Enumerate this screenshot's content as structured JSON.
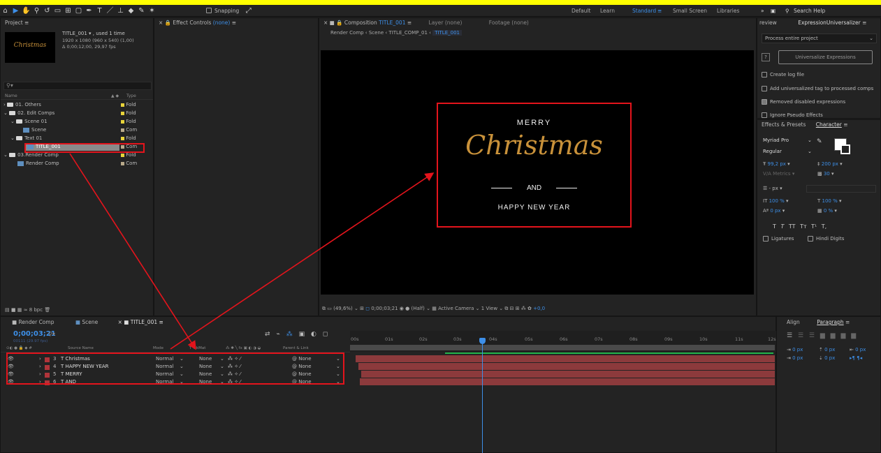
{
  "toolbar": {
    "snapping": "Snapping"
  },
  "workspaces": [
    "Default",
    "Learn",
    "Standard",
    "Small Screen",
    "Libraries"
  ],
  "search_help": "Search Help",
  "project": {
    "tab": "Project",
    "asset_name": "TITLE_001",
    "asset_used": ", used 1 time",
    "asset_dims": "1920 x 1080  (960 x 540) (1,00)",
    "asset_time": "Δ 0;00;12;00, 29,97 fps",
    "thumb_text": "Christmas",
    "col_name": "Name",
    "col_type": "Type",
    "items": [
      {
        "label": "01. Others",
        "type": "Fold"
      },
      {
        "label": "02. Edit Comps",
        "type": "Fold"
      },
      {
        "label": "Scene 01",
        "type": "Fold"
      },
      {
        "label": "Scene",
        "type": "Com"
      },
      {
        "label": "Text 01",
        "type": "Fold"
      },
      {
        "label": "TITLE_001",
        "type": "Com"
      },
      {
        "label": "03.Render Comp",
        "type": "Fold"
      },
      {
        "label": "Render Comp",
        "type": "Com"
      }
    ],
    "bpc": "8 bpc"
  },
  "effect_controls": {
    "label": "Effect Controls",
    "value": "(none)"
  },
  "composition": {
    "tab_prefix": "Composition",
    "tab_name": "TITLE_001",
    "layer_tab": "Layer  (none)",
    "footage_tab": "Footage  (none)",
    "breadcrumbs": [
      "Render Comp",
      "Scene",
      "TITLE_COMP_01",
      "TITLE_001"
    ],
    "title_merry": "MERRY",
    "title_christmas": "Christmas",
    "title_and": "AND",
    "title_happy": "HAPPY NEW YEAR",
    "zoom": "(49,6%)",
    "timecode": "0;00;03;21",
    "resolution": "(Half)",
    "camera": "Active Camera",
    "view": "1 View",
    "exposure": "+0,0"
  },
  "expression_panel": {
    "tab_review": "review",
    "tab_name": "ExpressionUniversalizer",
    "scope": "Process entire project",
    "button": "Universalize Expressions",
    "options": [
      {
        "label": "Create log file",
        "checked": false
      },
      {
        "label": "Add universalized tag to processed comps",
        "checked": false
      },
      {
        "label": "Removed disabled expressions",
        "checked": true
      },
      {
        "label": "Ignore Pseudo Effects",
        "checked": false
      }
    ]
  },
  "character": {
    "tab_effects": "Effects & Presets",
    "tab_character": "Character",
    "font": "Myriad Pro",
    "style": "Regular",
    "size": "99,2 px",
    "leading": "200 px",
    "kerning": "Metrics",
    "tracking": "30",
    "stroke": "- px",
    "vscale": "100 %",
    "hscale": "100 %",
    "baseline": "0 px",
    "tsume": "0 %",
    "style_buttons": [
      "T",
      "T",
      "TT",
      "Tт",
      "T¹",
      "T,"
    ],
    "ligatures": "Ligatures",
    "hindi": "Hindi Digits"
  },
  "timeline": {
    "tabs": [
      "Render Comp",
      "Scene",
      "TITLE_001"
    ],
    "timecode": "0;00;03;21",
    "frames": "00111 (29.97 fps)",
    "col_source": "Source Name",
    "col_mode": "Mode",
    "col_trk": "T  TrkMat",
    "col_parent": "Parent & Link",
    "layers": [
      {
        "num": "3",
        "name": "Christmas",
        "mode": "Normal",
        "trk": "None",
        "parent": "None"
      },
      {
        "num": "4",
        "name": "HAPPY NEW YEAR",
        "mode": "Normal",
        "trk": "None",
        "parent": "None"
      },
      {
        "num": "5",
        "name": "MERRY",
        "mode": "Normal",
        "trk": "None",
        "parent": "None"
      },
      {
        "num": "6",
        "name": "AND",
        "mode": "Normal",
        "trk": "None",
        "parent": "None"
      }
    ],
    "ticks": [
      "00s",
      "01s",
      "02s",
      "03s",
      "04s",
      "05s",
      "06s",
      "07s",
      "08s",
      "09s",
      "10s",
      "11s",
      "12s"
    ]
  },
  "align_paragraph": {
    "tab_align": "Align",
    "tab_paragraph": "Paragraph",
    "indent_left": "0 px",
    "indent_right": "0 px",
    "space_before": "0 px",
    "first_line": "0 px",
    "space_after": "0 px"
  },
  "colors": {
    "accent": "#3d8fe8",
    "highlight_red": "#e4141c",
    "label_red": "#b0343a",
    "label_yellow": "#e8d33a",
    "gold": "#c8913a"
  }
}
